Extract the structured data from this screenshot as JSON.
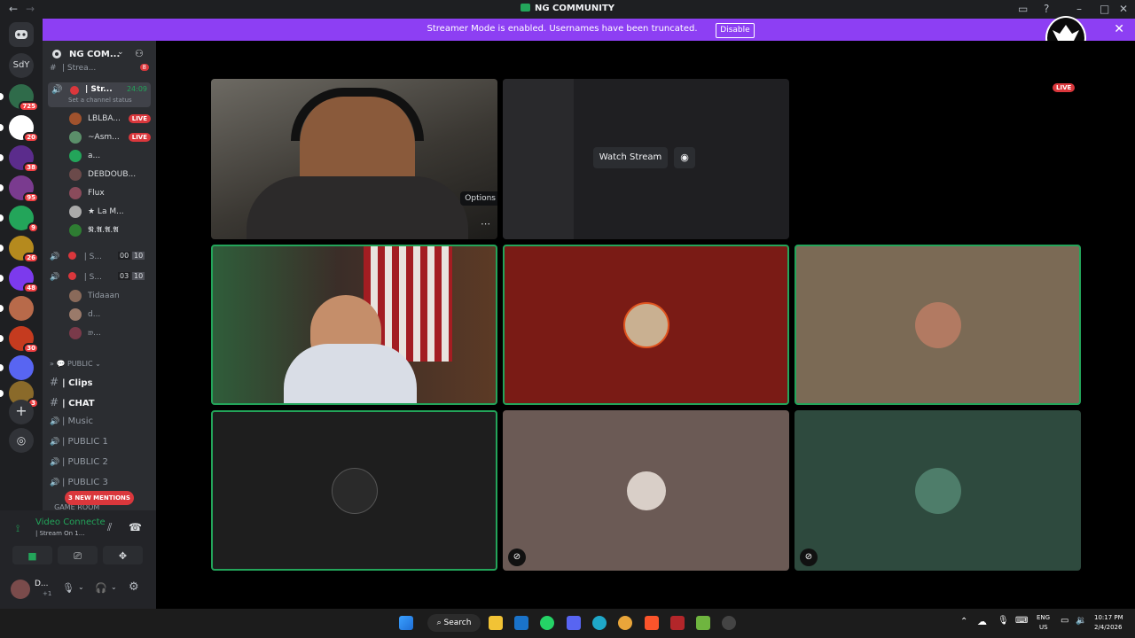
{
  "window": {
    "title": "NG COMMUNITY",
    "back_icon": "arrow-left-icon",
    "forward_icon": "arrow-right-icon"
  },
  "banner": {
    "message": "Streamer Mode is enabled. Usernames have been truncated.",
    "disable_label": "Disable",
    "color": "#8d3ff3"
  },
  "server_rail": {
    "home_icon": "discord-icon",
    "dm_label": "SdY",
    "servers": [
      {
        "badge": "725",
        "color": "#2f6b4a"
      },
      {
        "badge": "20",
        "color": "#ffffff"
      },
      {
        "badge": "38",
        "color": "#5b2c8c"
      },
      {
        "badge": "95",
        "color": "#7a3b8f"
      },
      {
        "badge": "9",
        "color": "#23a55a"
      },
      {
        "badge": "26",
        "color": "#b58a1e"
      },
      {
        "badge": "48",
        "color": "#7c3aed"
      },
      {
        "badge": "",
        "color": "#b86a4a"
      },
      {
        "badge": "30",
        "color": "#c53b1f"
      },
      {
        "badge": "",
        "color": "#5865f2"
      },
      {
        "badge": "3",
        "color": "#8a6a2a"
      }
    ]
  },
  "server": {
    "name": "NG COM...",
    "invite_icon": "add-person-icon"
  },
  "channels": {
    "top_partial": "| Strea...",
    "top_partial_count": "8",
    "active_voice": {
      "name": "| Str...",
      "time": "24:09",
      "status_placeholder": "Set a channel status"
    },
    "members": [
      {
        "name": "LBLBA...",
        "live": "LIVE"
      },
      {
        "name": "~Asm...",
        "live": "LIVE"
      },
      {
        "name": "a...",
        "live": ""
      },
      {
        "name": "DEBDOUB...",
        "live": ""
      },
      {
        "name": "Flux",
        "live": ""
      },
      {
        "name": "★ La M...",
        "live": ""
      },
      {
        "name": "𝕹.𝕬.𝕬.𝕬",
        "live": ""
      }
    ],
    "voice_a": {
      "name": "| S...",
      "c1": "00",
      "c2": "10"
    },
    "voice_b": {
      "name": "| S...",
      "c1": "03",
      "c2": "10"
    },
    "voice_b_members": [
      "Tidaaan",
      "d...",
      "𝔴..."
    ],
    "category_public": "PUBLIC",
    "public_channels": [
      {
        "name": "Clips",
        "bold": true
      },
      {
        "name": "CHAT",
        "bold": true
      },
      {
        "name": "Music",
        "bold": false
      },
      {
        "name": "PUBLIC 1",
        "bold": false
      },
      {
        "name": "PUBLIC 2",
        "bold": false
      },
      {
        "name": "PUBLIC 3",
        "bold": false
      }
    ],
    "category_partial": "GAME ROOM",
    "new_mentions": "3 NEW MENTIONS"
  },
  "voice_panel": {
    "status": "Video Connecte",
    "channel": "| Stream On 1..."
  },
  "user_panel": {
    "name": "D...",
    "sub": "+1"
  },
  "stage": {
    "watch_stream_label": "Watch Stream",
    "options_tooltip": "Options",
    "live_badge": "LIVE"
  },
  "taskbar": {
    "search_label": "Search",
    "lang_top": "ENG",
    "lang_bottom": "US",
    "time": "10:17 PM",
    "date": "2/4/2026"
  }
}
